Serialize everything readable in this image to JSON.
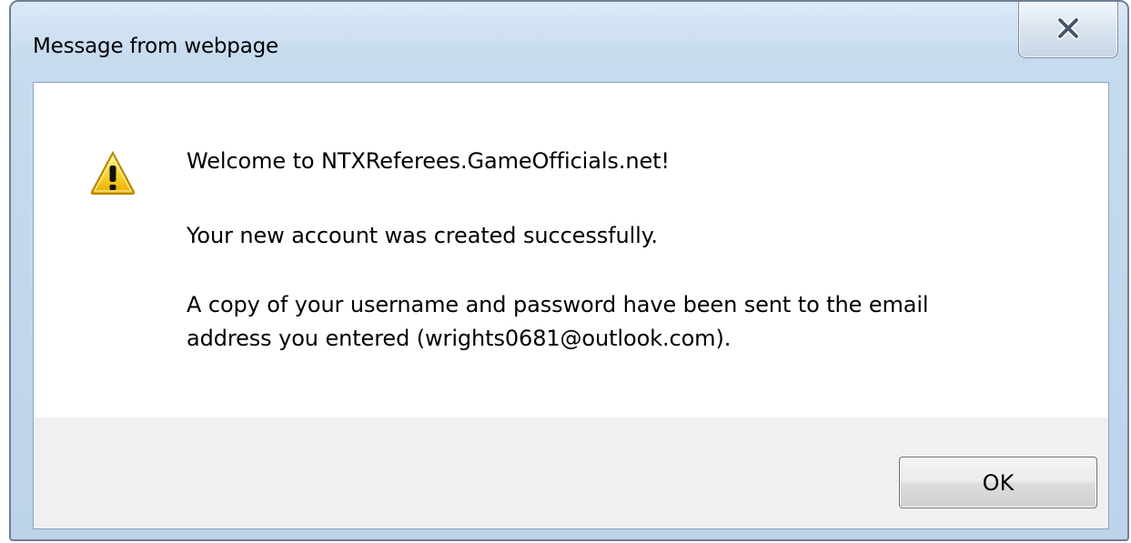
{
  "dialog": {
    "title": "Message from webpage",
    "icon": "warning-icon",
    "message": {
      "welcome": "Welcome to NTXReferees.GameOfficials.net!",
      "created": "Your new account was created successfully.",
      "copy_line1": "A copy of your username and password have been sent to the email",
      "copy_line2": "address you entered (wrights0681@outlook.com)."
    },
    "buttons": {
      "close_icon": "close-icon",
      "ok_label": "OK"
    }
  },
  "colors": {
    "frame": "#c7dbef",
    "client_background": "#ffffff",
    "footer_background": "#f0f0f0",
    "warning_yellow": "#f6c600"
  }
}
